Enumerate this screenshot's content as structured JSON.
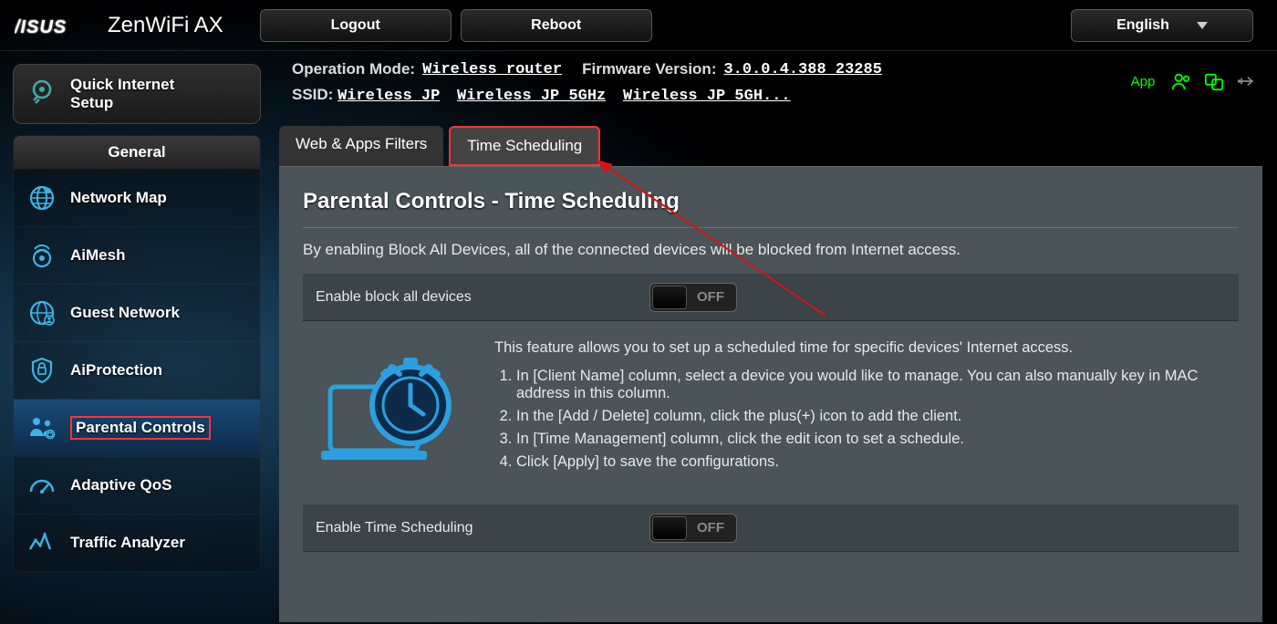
{
  "header": {
    "brand": "ASUS",
    "product": "ZenWiFi AX",
    "logout": "Logout",
    "reboot": "Reboot",
    "language": "English"
  },
  "info": {
    "mode_label": "Operation Mode:",
    "mode_value": "Wireless router",
    "fw_label": "Firmware Version:",
    "fw_value": "3.0.0.4.388_23285",
    "ssid_label": "SSID:",
    "ssid1": "Wireless JP",
    "ssid2": "Wireless JP 5GHz",
    "ssid3": "Wireless JP 5GH...",
    "app": "App"
  },
  "sidebar": {
    "qis_icon": "gear-setup-icon",
    "qis": "Quick Internet\nSetup",
    "section": "General",
    "items": [
      {
        "icon": "globe-icon",
        "label": "Network Map"
      },
      {
        "icon": "mesh-icon",
        "label": "AiMesh"
      },
      {
        "icon": "guest-icon",
        "label": "Guest Network"
      },
      {
        "icon": "shield-icon",
        "label": "AiProtection"
      },
      {
        "icon": "family-icon",
        "label": "Parental Controls",
        "active": true
      },
      {
        "icon": "gauge-icon",
        "label": "Adaptive QoS"
      },
      {
        "icon": "traffic-icon",
        "label": "Traffic Analyzer"
      }
    ]
  },
  "tabs": {
    "filters": "Web & Apps Filters",
    "schedule": "Time Scheduling"
  },
  "content": {
    "title": "Parental Controls - Time Scheduling",
    "desc1": "By enabling Block All Devices, all of the connected devices will be blocked from Internet access.",
    "block_all_label": "Enable block all devices",
    "block_all_state": "OFF",
    "feature_intro": "This feature allows you to set up a scheduled time for specific devices' Internet access.",
    "step1": "In [Client Name] column, select a device you would like to manage. You can also manually key in MAC address in this column.",
    "step2": "In the [Add / Delete] column, click the plus(+) icon to add the client.",
    "step3": "In [Time Management] column, click the edit icon to set a schedule.",
    "step4": "Click [Apply] to save the configurations.",
    "time_label": "Enable Time Scheduling",
    "time_state": "OFF"
  }
}
